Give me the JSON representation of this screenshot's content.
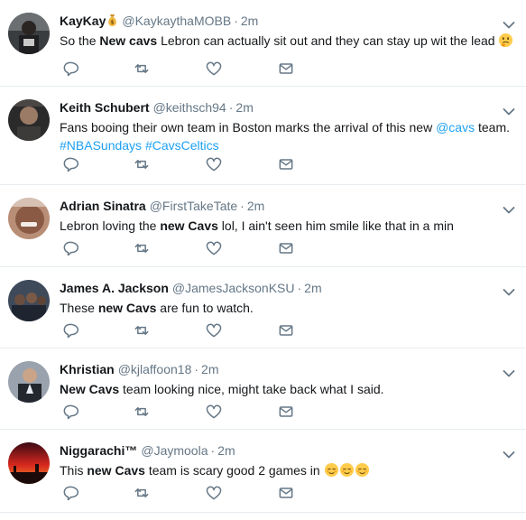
{
  "colors": {
    "accent": "#1da1f2",
    "secondary_text": "#657786",
    "divider": "#e6ecf0"
  },
  "tweets": [
    {
      "name": "KayKay",
      "handle": "@KaykaythaMOBB",
      "time": "2m",
      "name_emoji": "money-bag",
      "parts": [
        {
          "t": "So the "
        },
        {
          "b": "New cavs"
        },
        {
          "t": " Lebron can actually sit out and they can stay up wit the lead "
        }
      ],
      "trailing_emojis": [
        "thinking-face"
      ]
    },
    {
      "name": "Keith Schubert",
      "handle": "@keithsch94",
      "time": "2m",
      "parts": [
        {
          "t": "Fans booing their own team in Boston marks the arrival of this new "
        },
        {
          "l": "@cavs"
        },
        {
          "t": " team. "
        },
        {
          "l": "#NBASundays"
        },
        {
          "t": " "
        },
        {
          "l": "#CavsCeltics"
        }
      ]
    },
    {
      "name": "Adrian Sinatra",
      "handle": "@FirstTakeTate",
      "time": "2m",
      "parts": [
        {
          "t": "Lebron loving the "
        },
        {
          "b": "new Cavs"
        },
        {
          "t": " lol, I ain't seen him smile like that in a min"
        }
      ]
    },
    {
      "name": "James A. Jackson",
      "handle": "@JamesJacksonKSU",
      "time": "2m",
      "parts": [
        {
          "t": "These "
        },
        {
          "b": "new Cavs"
        },
        {
          "t": " are fun to watch."
        }
      ]
    },
    {
      "name": "Khristian",
      "handle": "@kjlaffoon18",
      "time": "2m",
      "parts": [
        {
          "b": "New Cavs"
        },
        {
          "t": " team looking nice, might take back what I said."
        }
      ]
    },
    {
      "name": "Niggarachi™",
      "handle": "@Jaymoola",
      "time": "2m",
      "parts": [
        {
          "t": "This "
        },
        {
          "b": "new Cavs"
        },
        {
          "t": " team is scary good 2 games in "
        }
      ],
      "trailing_emojis": [
        "relieved-face",
        "relieved-face",
        "relieved-face"
      ]
    }
  ],
  "actions": [
    "reply-icon",
    "retweet-icon",
    "like-icon",
    "direct-message-icon"
  ],
  "menu_icon": "chevron-down-icon",
  "separator": "·"
}
